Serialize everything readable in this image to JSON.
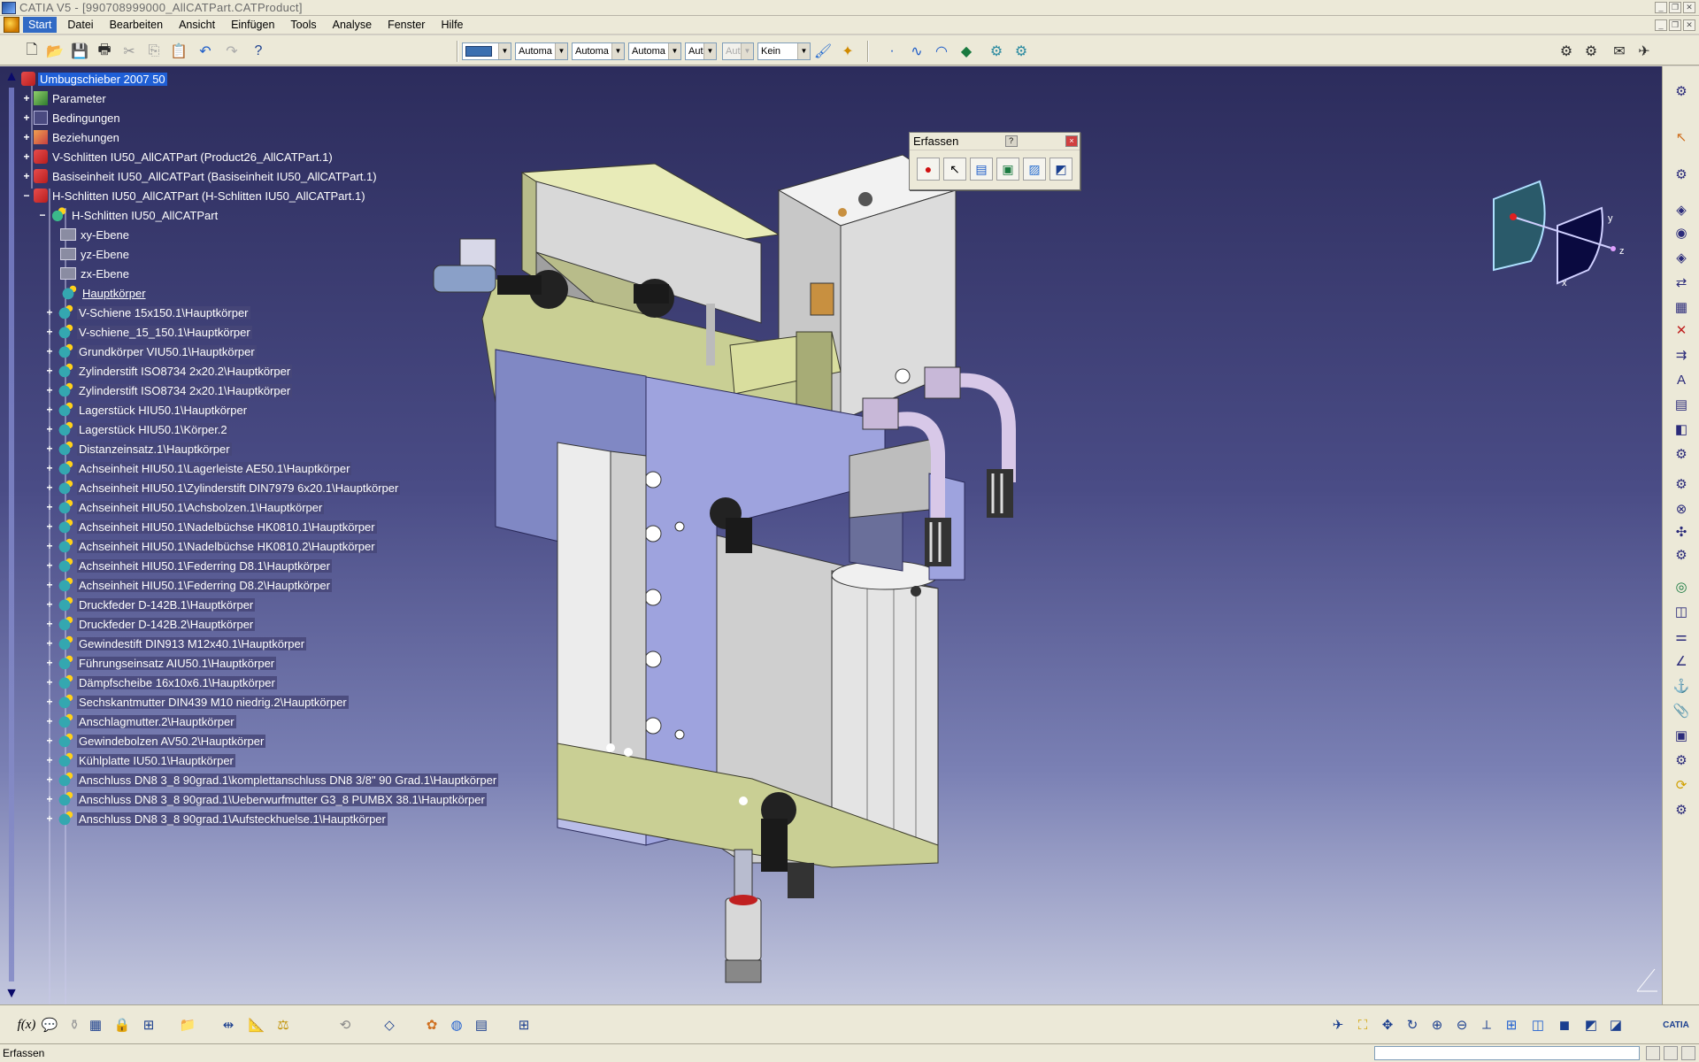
{
  "window": {
    "title": "CATIA V5 - [990708999000_AllCATPart.CATProduct]"
  },
  "menu": [
    "Start",
    "Datei",
    "Bearbeiten",
    "Ansicht",
    "Einfügen",
    "Tools",
    "Analyse",
    "Fenster",
    "Hilfe"
  ],
  "toolbar": {
    "combos": [
      "Automa",
      "Automa",
      "Automa",
      "Aut",
      "Aut",
      "Kein"
    ]
  },
  "tree": {
    "root": "Umbugschieber 2007 50",
    "top": [
      "Parameter",
      "Bedingungen",
      "Beziehungen",
      "V-Schlitten IU50_AllCATPart (Product26_AllCATPart.1)",
      "Basiseinheit IU50_AllCATPart (Basiseinheit IU50_AllCATPart.1)",
      "H-Schlitten IU50_AllCATPart (H-Schlitten IU50_AllCATPart.1)"
    ],
    "part": "H-Schlitten IU50_AllCATPart",
    "planes": [
      "xy-Ebene",
      "yz-Ebene",
      "zx-Ebene"
    ],
    "main_body": "Hauptkörper",
    "bodies": [
      "V-Schiene 15x150.1\\Hauptkörper",
      "V-schiene_15_150.1\\Hauptkörper",
      "Grundkörper VIU50.1\\Hauptkörper",
      "Zylinderstift ISO8734 2x20.2\\Hauptkörper",
      "Zylinderstift ISO8734 2x20.1\\Hauptkörper",
      "Lagerstück HIU50.1\\Hauptkörper",
      "Lagerstück HIU50.1\\Körper.2",
      "Distanzeinsatz.1\\Hauptkörper",
      "Achseinheit HIU50.1\\Lagerleiste AE50.1\\Hauptkörper",
      "Achseinheit HIU50.1\\Zylinderstift DIN7979 6x20.1\\Hauptkörper",
      "Achseinheit HIU50.1\\Achsbolzen.1\\Hauptkörper",
      "Achseinheit HIU50.1\\Nadelbüchse HK0810.1\\Hauptkörper",
      "Achseinheit HIU50.1\\Nadelbüchse HK0810.2\\Hauptkörper",
      "Achseinheit HIU50.1\\Federring D8.1\\Hauptkörper",
      "Achseinheit HIU50.1\\Federring D8.2\\Hauptkörper",
      "Druckfeder D-142B.1\\Hauptkörper",
      "Druckfeder D-142B.2\\Hauptkörper",
      "Gewindestift DIN913 M12x40.1\\Hauptkörper",
      "Führungseinsatz AIU50.1\\Hauptkörper",
      "Dämpfscheibe 16x10x6.1\\Hauptkörper",
      "Sechskantmutter DIN439 M10 niedrig.2\\Hauptkörper",
      "Anschlagmutter.2\\Hauptkörper",
      "Gewindebolzen AV50.2\\Hauptkörper",
      "Kühlplatte IU50.1\\Hauptkörper",
      "Anschluss DN8 3_8 90grad.1\\komplettanschluss DN8 3/8\" 90 Grad.1\\Hauptkörper",
      "Anschluss DN8 3_8 90grad.1\\Ueberwurfmutter G3_8 PUMBX 38.1\\Hauptkörper",
      "Anschluss DN8 3_8 90grad.1\\Aufsteckhuelse.1\\Hauptkörper"
    ]
  },
  "erfassen": {
    "title": "Erfassen",
    "help": "?",
    "close": "×"
  },
  "compass": {
    "y": "y",
    "z": "z",
    "x": "x"
  },
  "status": {
    "text": "Erfassen"
  },
  "brand": "CATIA"
}
